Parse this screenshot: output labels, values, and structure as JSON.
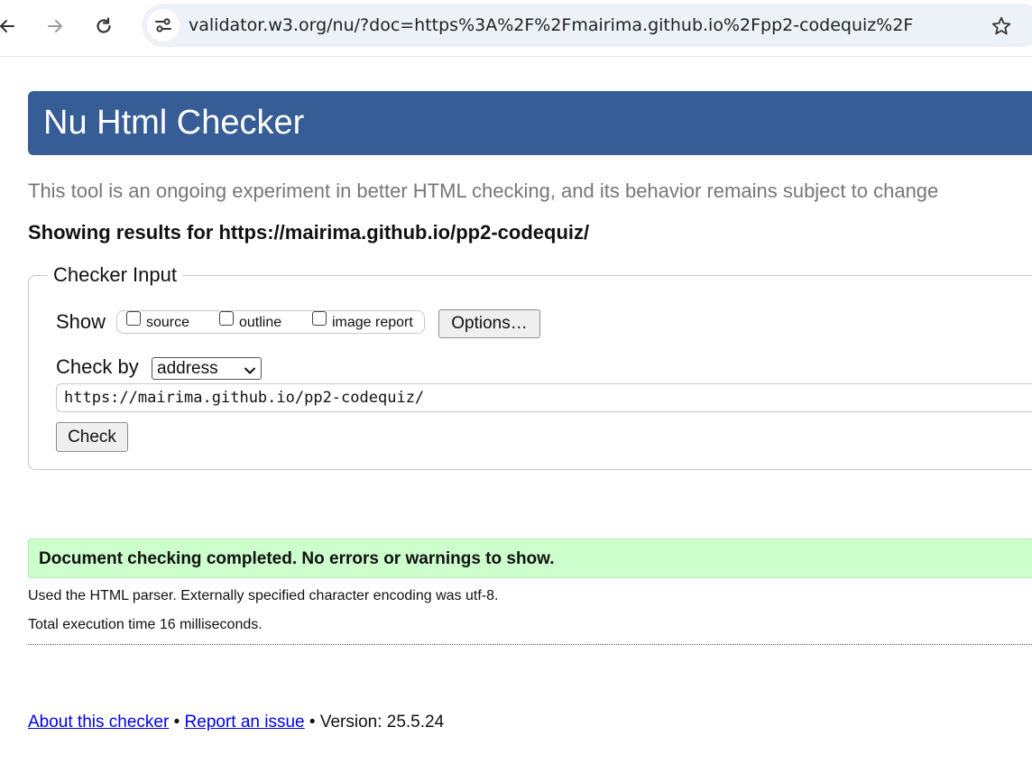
{
  "browser": {
    "url": "validator.w3.org/nu/?doc=https%3A%2F%2Fmairima.github.io%2Fpp2-codequiz%2F",
    "icons": {
      "back": "back-arrow-icon",
      "forward": "forward-arrow-icon",
      "reload": "reload-icon",
      "site_info": "site-settings-icon",
      "bookmark": "star-icon"
    }
  },
  "page": {
    "title": "Nu Html Checker",
    "header_color": "#365d95",
    "intro": "This tool is an ongoing experiment in better HTML checking, and its behavior remains subject to change",
    "results_for": "Showing results for https://mairima.github.io/pp2-codequiz/"
  },
  "checker_input": {
    "legend": "Checker Input",
    "show_label": "Show",
    "checkboxes": [
      {
        "label": "source",
        "checked": false
      },
      {
        "label": "outline",
        "checked": false
      },
      {
        "label": "image report",
        "checked": false
      }
    ],
    "options_button": "Options…",
    "check_by_label": "Check by",
    "check_by_value": "address",
    "url_value": "https://mairima.github.io/pp2-codequiz/",
    "check_button": "Check"
  },
  "results": {
    "success_message": "Document checking completed. No errors or warnings to show.",
    "success_color": "#ccffcc",
    "parser_info": "Used the HTML parser. Externally specified character encoding was utf-8.",
    "execution_time": "Total execution time 16 milliseconds."
  },
  "footer": {
    "about_link": "About this checker",
    "separator": "•",
    "report_link": "Report an issue",
    "version": "Version: 25.5.24"
  }
}
